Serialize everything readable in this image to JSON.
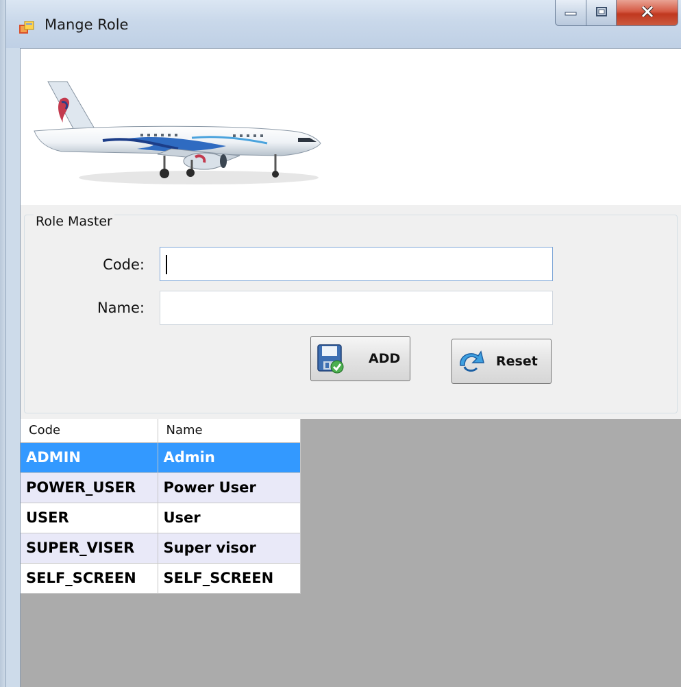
{
  "window": {
    "title": "Mange Role",
    "minimize_icon": "minimize-icon",
    "maximize_icon": "maximize-icon",
    "close_icon": "close-icon"
  },
  "banner": {
    "image": "airplane-banner"
  },
  "role_master": {
    "group_title": "Role Master",
    "code_label": "Code:",
    "code_value": "",
    "name_label": "Name:",
    "name_value": "",
    "add_button": {
      "label": "ADD",
      "icon": "save-icon"
    },
    "reset_button": {
      "label": "Reset",
      "icon": "refresh-icon"
    }
  },
  "grid": {
    "columns": [
      "Code",
      "Name"
    ],
    "selected_row": 0,
    "rows": [
      {
        "code": "ADMIN",
        "name": "Admin"
      },
      {
        "code": "POWER_USER",
        "name": "Power User"
      },
      {
        "code": "USER",
        "name": "User"
      },
      {
        "code": "SUPER_VISER",
        "name": "Super visor"
      },
      {
        "code": "SELF_SCREEN",
        "name": "SELF_SCREEN"
      }
    ]
  }
}
